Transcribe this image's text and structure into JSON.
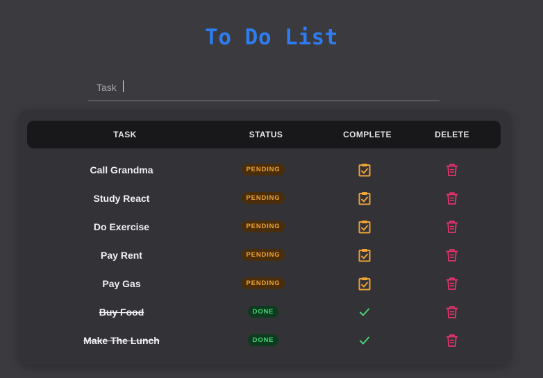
{
  "app": {
    "title": "To Do List"
  },
  "input": {
    "placeholder": "Task",
    "value": ""
  },
  "table": {
    "headers": {
      "task": "TASK",
      "status": "STATUS",
      "complete": "COMPLETE",
      "delete": "DELETE"
    },
    "rows": [
      {
        "task": "Call Grandma",
        "status": "PENDING",
        "done": false
      },
      {
        "task": "Study React",
        "status": "PENDING",
        "done": false
      },
      {
        "task": "Do Exercise",
        "status": "PENDING",
        "done": false
      },
      {
        "task": "Pay Rent",
        "status": "PENDING",
        "done": false
      },
      {
        "task": "Pay Gas",
        "status": "PENDING",
        "done": false
      },
      {
        "task": "Buy Food",
        "status": "DONE",
        "done": true
      },
      {
        "task": "Make The Lunch",
        "status": "DONE",
        "done": true
      }
    ]
  },
  "icons": {
    "complete_pending": "clipboard-check-icon",
    "complete_done": "check-icon",
    "delete": "trash-icon"
  },
  "colors": {
    "accent": "#2f7bf0",
    "pending_text": "#f0a336",
    "pending_bg": "#4a2e0c",
    "done_text": "#4ad37a",
    "done_bg": "#0d3b1e",
    "delete": "#e8336e",
    "complete_icon": "#f0a336",
    "check": "#4ad37a"
  }
}
